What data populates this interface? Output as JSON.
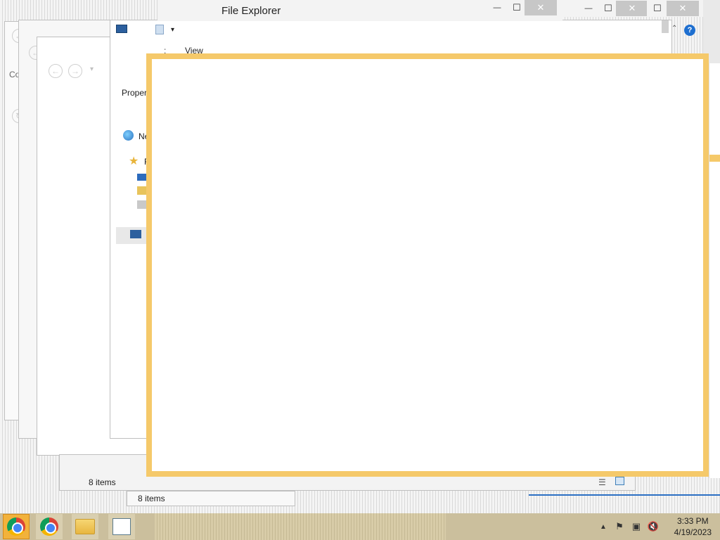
{
  "main_window": {
    "title": "File Explorer",
    "controls": {
      "minimize": "—",
      "maximize": "☐",
      "close": "✕"
    }
  },
  "back_windows": {
    "controls2": {
      "minimize": "—",
      "maximize": "☐",
      "close": "✕"
    },
    "controls3": {
      "maximize": "☐",
      "close": "✕"
    },
    "ribbon_tab_view": "View",
    "ribbon_tab_partial": ":",
    "left_label_co": "Co",
    "properties_partial": "Propert",
    "network_partial": "Ne",
    "fav_partial": "F",
    "status_items_1": "8 items",
    "status_items_2": "8 items"
  },
  "taskbar": {
    "apps": [
      {
        "name": "Google Chrome"
      },
      {
        "name": "Google Chrome"
      },
      {
        "name": "File Explorer"
      },
      {
        "name": "App"
      }
    ],
    "clock": {
      "time": "3:33 PM",
      "date": "4/19/2023"
    }
  },
  "colors": {
    "taskbar": "#cbbf9d",
    "window_frame_active": "#f5c96a"
  }
}
